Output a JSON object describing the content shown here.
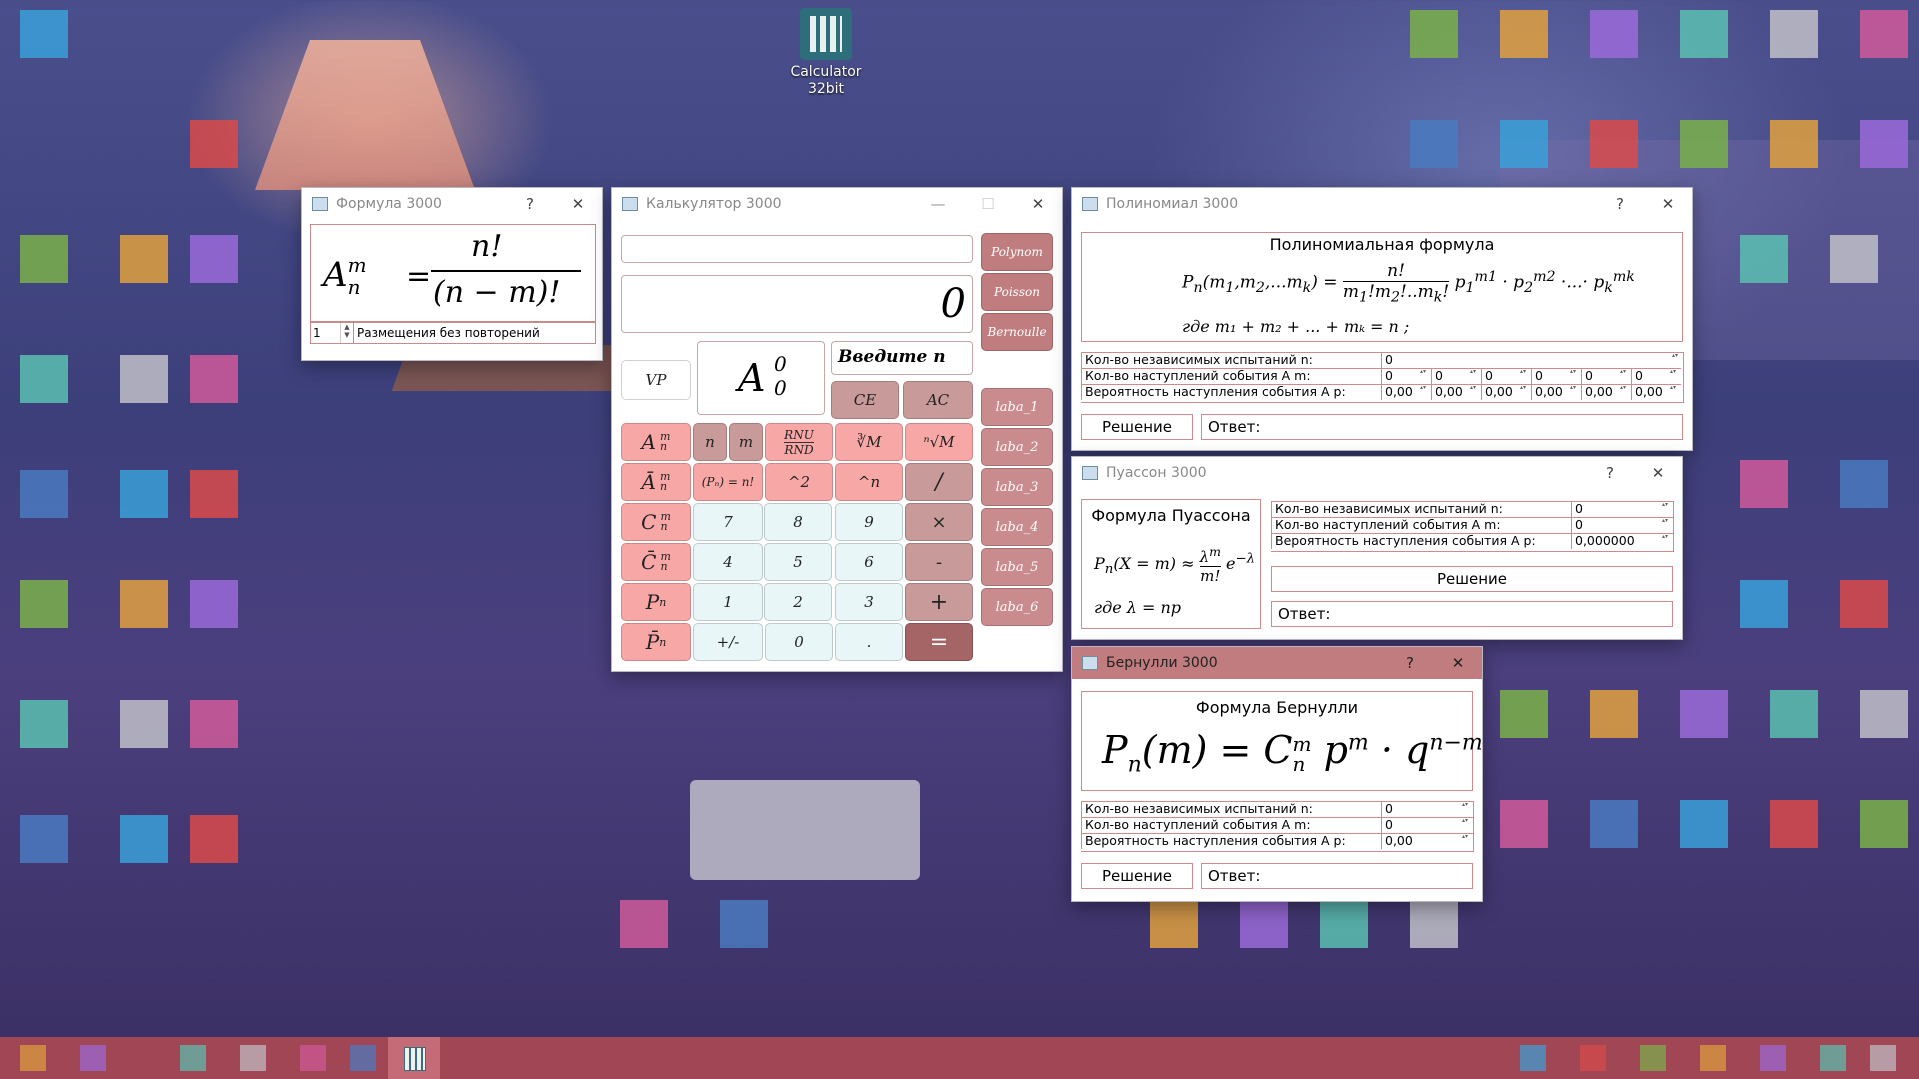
{
  "desktop": {
    "calculator_icon": {
      "label_line1": "Calculator",
      "label_line2": "32bit"
    }
  },
  "colors": {
    "accent": "#c07c7e",
    "pink_button": "#f7a7a6",
    "light_button": "#e8f6f8",
    "taskbar": "#a04654"
  },
  "formula_window": {
    "title": "Формула 3000",
    "help": "?",
    "close": "✕",
    "formula": {
      "lhs": "A",
      "sup": "m",
      "sub": "n",
      "numerator": "n!",
      "denominator": "(n − m)!"
    },
    "spin_value": "1",
    "description": "Размещения без повторений"
  },
  "calculator_window": {
    "title": "Калькулятор 3000",
    "minimize": "—",
    "maximize": "☐",
    "close": "✕",
    "input_top": "",
    "display": "0",
    "vp": "VP",
    "mini_display": {
      "symbol": "A",
      "top": "0",
      "bottom": "0"
    },
    "prompt": "Введите n",
    "ce": "CE",
    "ac": "AC",
    "side_buttons": [
      "Polynom",
      "Poisson",
      "Bernoulle",
      "laba_1",
      "laba_2",
      "laba_3",
      "laba_4",
      "laba_5",
      "laba_6"
    ],
    "func_col1": [
      "A",
      "Ā",
      "C",
      "C̄",
      "P",
      "P̄"
    ],
    "row1": {
      "n": "n",
      "m": "m",
      "rnu": "RNU",
      "rnd": "RND",
      "root3": "∛M",
      "rootn": "ⁿ√M"
    },
    "row2": {
      "pn": "(Pₙ) = n!",
      "sq": "^2",
      "pow": "^n",
      "div": "/"
    },
    "digits_row3": [
      "7",
      "8",
      "9"
    ],
    "mul": "×",
    "digits_row4": [
      "4",
      "5",
      "6"
    ],
    "minus": "-",
    "digits_row5": [
      "1",
      "2",
      "3"
    ],
    "plus": "+",
    "plusminus": "+/-",
    "zero": "0",
    "dot": ".",
    "equals": "="
  },
  "polynomial_window": {
    "title": "Полиномиал 3000",
    "help": "?",
    "close": "✕",
    "heading": "Полиномиальная формула",
    "where_text": "где  m₁ + m₂ + ... + mₖ = n ;",
    "rows": [
      {
        "label": "Кол-во независимых испытаний n:",
        "values": [
          "0"
        ]
      },
      {
        "label": "Кол-во наступлений события А m:",
        "values": [
          "0",
          "0",
          "0",
          "0",
          "0",
          "0"
        ]
      },
      {
        "label": "Вероятность наступления события А p:",
        "values": [
          "0,00",
          "0,00",
          "0,00",
          "0,00",
          "0,00",
          "0,00"
        ]
      }
    ],
    "solve": "Решение",
    "answer": "Ответ:"
  },
  "poisson_window": {
    "title": "Пуассон 3000",
    "help": "?",
    "close": "✕",
    "heading": "Формула Пуассона",
    "where_text": "где λ = np",
    "rows": [
      {
        "label": "Кол-во независимых испытаний n:",
        "value": "0"
      },
      {
        "label": "Кол-во наступлений события А m:",
        "value": "0"
      },
      {
        "label": "Вероятность наступления события А p:",
        "value": "0,000000"
      }
    ],
    "solve": "Решение",
    "answer": "Ответ:"
  },
  "bernoulli_window": {
    "title": "Бернулли 3000",
    "help": "?",
    "close": "✕",
    "heading": "Формула Бернулли",
    "rows": [
      {
        "label": "Кол-во независимых испытаний n:",
        "value": "0"
      },
      {
        "label": "Кол-во наступлений события А m:",
        "value": "0"
      },
      {
        "label": "Вероятность наступления события А p:",
        "value": "0,00"
      }
    ],
    "solve": "Решение",
    "answer": "Ответ:"
  }
}
